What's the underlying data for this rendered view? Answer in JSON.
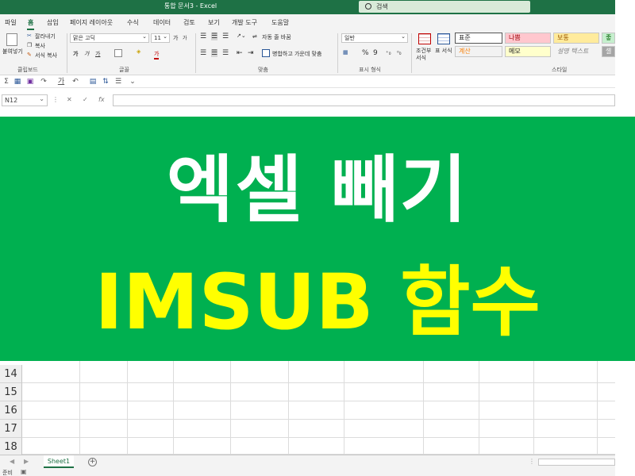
{
  "window": {
    "title": "통합 문서3  -  Excel",
    "search_placeholder": "검색",
    "accent": "#1e7145"
  },
  "menu": {
    "tabs": [
      "파일",
      "홈",
      "삽입",
      "페이지 레이아웃",
      "수식",
      "데이터",
      "검토",
      "보기",
      "개발 도구",
      "도움말"
    ],
    "active": "홈"
  },
  "ribbon": {
    "clipboard": {
      "paste": "붙여넣기",
      "cut": "잘라내기",
      "copy": "복사",
      "format_painter": "서식 복사",
      "label": "클립보드"
    },
    "font": {
      "name": "맑은 고딕",
      "size": "11",
      "grow": "가",
      "shrink": "가",
      "bold": "가",
      "italic": "가",
      "underline": "가",
      "color_a": "가",
      "label": "글꼴"
    },
    "alignment": {
      "wrap_text": "자동 줄 바꿈",
      "merge_center": "병합하고 가운데 맞춤",
      "label": "맞춤"
    },
    "number": {
      "format": "일반",
      "percent": "%",
      "comma": "9",
      "label": "표시 형식"
    },
    "styles": {
      "conditional": "조건부 서식",
      "table": "표 서식",
      "cells": [
        {
          "text": "표준",
          "bg": "#ffffff",
          "color": "#222222"
        },
        {
          "text": "나쁨",
          "bg": "#ffc7ce",
          "color": "#9c0006"
        },
        {
          "text": "보통",
          "bg": "#ffeb9c",
          "color": "#9c5700"
        },
        {
          "text": "좋음",
          "bg": "#c6efce",
          "color": "#006100"
        },
        {
          "text": "계산",
          "bg": "#f2f2f2",
          "color": "#fa7d00"
        },
        {
          "text": "메모",
          "bg": "#ffffcc",
          "color": "#222222"
        },
        {
          "text": "설명 텍스트",
          "bg": "#f3f3f3",
          "color": "#7f7f7f"
        },
        {
          "text": "셀",
          "bg": "#a5a5a5",
          "color": "#ffffff"
        }
      ],
      "label": "스타일"
    }
  },
  "formula_bar": {
    "name_box": "N12",
    "fx": "fx",
    "value": ""
  },
  "banner": {
    "line1": "엑셀 빼기",
    "line2": "IMSUB 함수",
    "bg": "#00b050",
    "line1_color": "#ffffff",
    "line2_color": "#ffff00"
  },
  "grid": {
    "rows": [
      "14",
      "15",
      "16",
      "17",
      "18"
    ]
  },
  "sheets": {
    "tabs": [
      "Sheet1"
    ],
    "add": "+"
  },
  "status": {
    "text": "준비"
  }
}
